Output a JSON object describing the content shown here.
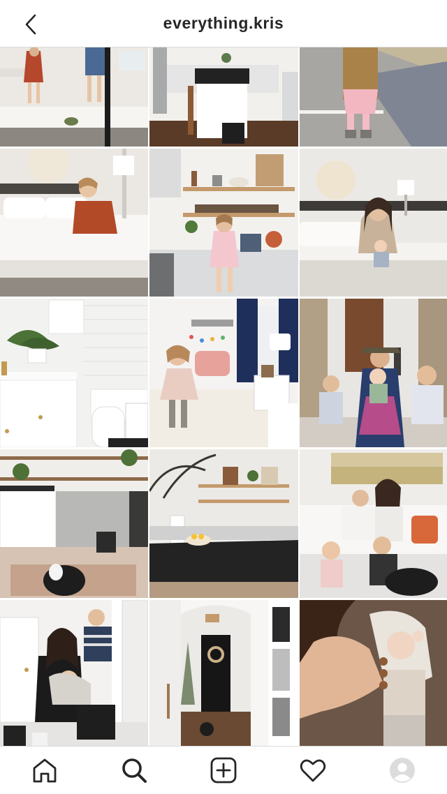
{
  "header": {
    "title": "everything.kris"
  },
  "icons": {
    "back": "chevron-left-icon",
    "home": "home-icon",
    "search": "search-icon",
    "new_post": "plus-square-icon",
    "activity": "heart-icon",
    "profile": "avatar-icon"
  },
  "colors": {
    "text": "#262626",
    "divider": "#dbdbdb",
    "background": "#ffffff"
  }
}
